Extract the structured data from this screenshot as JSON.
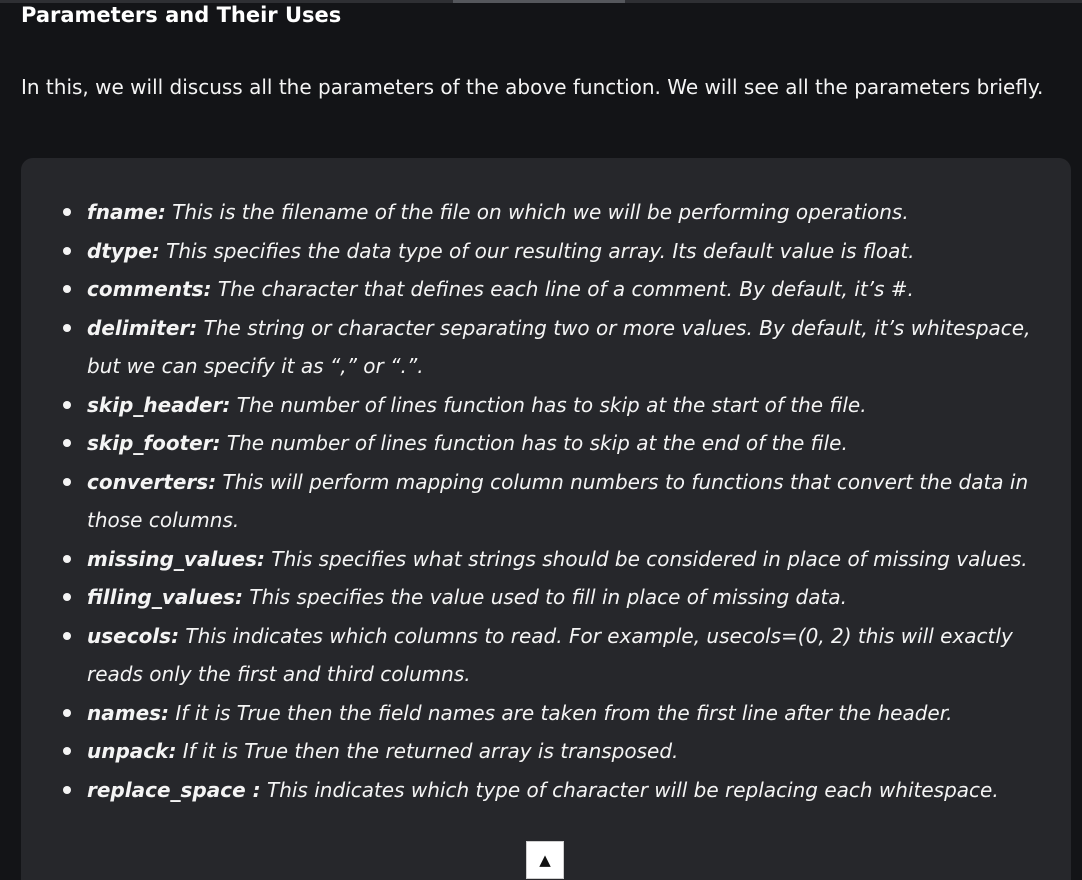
{
  "article": {
    "heading": "Parameters and Their Uses",
    "intro": "In this, we will discuss all the parameters of the above function. We will see all the parameters briefly.",
    "params": [
      {
        "name": "fname:",
        "desc": " This is the filename of the file on which we will be performing operations."
      },
      {
        "name": "dtype:",
        "desc": " This specifies the data type of our resulting array. Its default value is float."
      },
      {
        "name": "comments:",
        "desc": " The character that defines each line of a comment. By default, it’s #."
      },
      {
        "name": "delimiter:",
        "desc": " The string or character separating two or more values. By default, it’s whitespace, but we can specify it as “,” or “.”."
      },
      {
        "name": "skip_header:",
        "desc": " The number of lines function has to skip at the start of the file."
      },
      {
        "name": "skip_footer:",
        "desc": " The number of lines function has to skip at the end of the file."
      },
      {
        "name": "converters:",
        "desc": " This will perform mapping column numbers to functions that convert the data in those columns."
      },
      {
        "name": "missing_values:",
        "desc": " This specifies what strings should be considered in place of missing values."
      },
      {
        "name": "filling_values:",
        "desc": " This specifies the value used to fill in place of missing data."
      },
      {
        "name": "usecols:",
        "desc": " This indicates which columns to read. For example, usecols=(0, 2) this will exactly reads only the first and third columns."
      },
      {
        "name": "names:",
        "desc": " If it is True then the field names are taken from the first line after the header."
      },
      {
        "name": "unpack:",
        "desc": " If it is True then the returned array is transposed."
      },
      {
        "name": "replace_space :",
        "desc": " This indicates which type of character will be replacing each whitespace."
      }
    ]
  },
  "scroll_top": {
    "glyph": "▲",
    "icon": "arrow-up-icon"
  },
  "colors": {
    "background": "#131417",
    "card": "#26272b",
    "text": "#f4f4f4"
  }
}
